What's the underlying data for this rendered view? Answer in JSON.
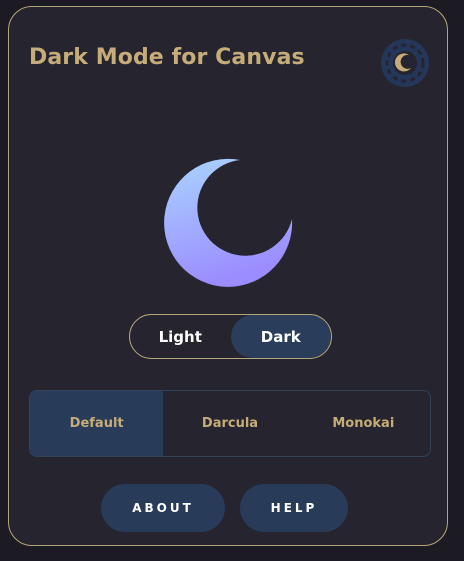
{
  "header": {
    "title": "Dark Mode for Canvas",
    "logo_icon": "moon-logo-icon"
  },
  "hero": {
    "icon": "crescent-moon-icon",
    "gradient_top": "#a9d4ff",
    "gradient_bottom": "#9b8cff"
  },
  "mode_toggle": {
    "options": [
      "Light",
      "Dark"
    ],
    "selected": "Dark"
  },
  "theme_selector": {
    "options": [
      "Default",
      "Darcula",
      "Monokai"
    ],
    "selected": "Default"
  },
  "buttons": {
    "about_label": "ABOUT",
    "help_label": "HELP"
  },
  "colors": {
    "background": "#25242f",
    "accent_gold": "#c5ac78",
    "accent_blue": "#283b59"
  }
}
